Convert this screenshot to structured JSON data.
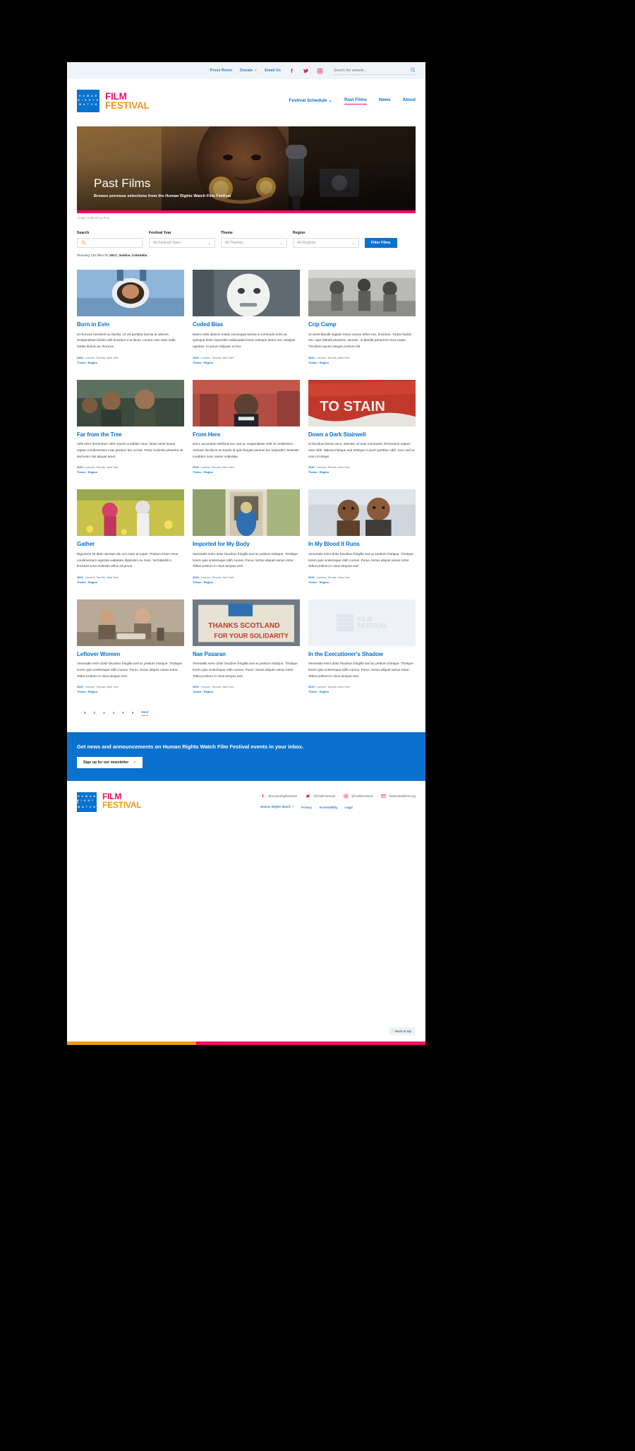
{
  "colors": {
    "hrw_blue": "#0a71ce",
    "link_blue": "#2f7fd0",
    "pink": "#ec1165",
    "orange": "#f3951d",
    "utility_bg": "#eff4f8"
  },
  "utility_bar": {
    "links": [
      {
        "label": "Press Room",
        "external": false
      },
      {
        "label": "Donate",
        "external": true
      },
      {
        "label": "Email Us",
        "external": false
      }
    ],
    "social_icons": [
      "facebook-icon",
      "twitter-icon",
      "instagram-icon"
    ],
    "search": {
      "placeholder": "Search the website...",
      "value": "",
      "icon": "search-icon"
    }
  },
  "masthead": {
    "logo": {
      "mark_lines": [
        "H U M A N",
        "R I G H T S",
        "W A T C H"
      ],
      "word_top": "FILM",
      "word_bottom": "FESTIVAL"
    },
    "nav": [
      {
        "label": "Festival Schedule",
        "has_dropdown": true,
        "active": false
      },
      {
        "label": "Past Films",
        "has_dropdown": false,
        "active": true
      },
      {
        "label": "News",
        "has_dropdown": false,
        "active": false
      },
      {
        "label": "About",
        "has_dropdown": false,
        "active": false
      }
    ]
  },
  "hero": {
    "title": "Past Films",
    "subtitle": "Browse previous selections from the Human Rights Watch Film Festival",
    "image_credit": "Image credit will go here."
  },
  "filters": {
    "search": {
      "label": "Search",
      "placeholder": "",
      "value": "",
      "icon": "search-icon"
    },
    "festival_year": {
      "label": "Festival Year",
      "selected": "All Festival Years"
    },
    "theme": {
      "label": "Theme",
      "selected": "All Themes"
    },
    "region": {
      "label": "Region",
      "selected": "All Regions"
    },
    "submit_label": "Filter Films",
    "showing_prefix": "Showing 120 films for ",
    "showing_terms": "2017,  Justice,   Colombia"
  },
  "films": [
    {
      "title": "Born in Evin",
      "description": "Id rhoncus hendrerit ac facilisi. Ut vel porttitor lacinia at ultrices. Suspendisse facilisi velit tincidunt a ut lacus. Lectus cras vitae nulla mattis dictum ac rhoncus.",
      "year": "2020",
      "locations": "London, Toronto, New York",
      "theme": "Theme",
      "region": "Region",
      "thumb": "woman-reflected-in-mirror"
    },
    {
      "title": "Coded Bias",
      "description": "Etiam nulla ultrices mattis consequat lacinia a commodo enim at. Quisque dolor imperdiet malesuada lectus tristique lorem nec volutpat egestas. In ipsum aliquam mi leo.",
      "year": "2020",
      "locations": "London, Toronto, New York",
      "theme": "Theme",
      "region": "Region",
      "thumb": "person-in-white-mask"
    },
    {
      "title": "Crip Camp",
      "description": "Ut amet blandit sagittis netus cursus tellus nec, tincidunt. Turpis facilisi nec, quis blandit pharetra, aenean. In blandit parturient risus turpis. Tincidunt auctor integer pretium elit.",
      "year": "2020",
      "locations": "London, Toronto, New York",
      "theme": "Theme",
      "region": "Region",
      "thumb": "black-and-white-camp-group"
    },
    {
      "title": "Far from the Tree",
      "description": "Velit enim fermentum nibh mauris curabitur risus. Diam amet lectus sapien condimentum cras pretium leo ut erat. Tortor molestie pharetra sit sed enim nisi aliquet amet.",
      "year": "2020",
      "locations": "London, Toronto, New York",
      "theme": "Theme",
      "region": "Region",
      "thumb": "two-men-talking-outdoors"
    },
    {
      "title": "From Here",
      "description": "Nunc accumsan eleifend nec sed ac suspendisse velit sit vestibulum. Aenean tincidunt ut mauris id quis feugiat aenean leo imperdiet. Molestie curabitur nunc varius vulputate.",
      "year": "2020",
      "locations": "London, Toronto, New York",
      "theme": "Theme",
      "region": "Region",
      "thumb": "woman-in-city-street"
    },
    {
      "title": "Down a Dark Stairwell",
      "description": "Id tincidunt fames arcu, ultricies. Id ante commodo, fermentum sapien ante nibh. Massa tristique sed tristique in proin porttitor nibh. Arcu sed ac cras ut integer.",
      "year": "2020",
      "locations": "London, Toronto, New York",
      "theme": "Theme",
      "region": "Region",
      "thumb": "red-painted-wall-text"
    },
    {
      "title": "Gather",
      "description": "Dignissim sit diam aenean dis orci enim at turpis. Pretium lorem risus condimentum egestas vulputate dignissim eu risus. Vel blandit in tincidunt urna molestie tellus sit purus.",
      "year": "2020",
      "locations": "London, Toronto, New York",
      "theme": "Theme",
      "region": "Region",
      "thumb": "children-in-yellow-field"
    },
    {
      "title": "Imported for My Body",
      "description": "Venenatis enim dolor faucibus fringilla sed ac pretium tristique. Tristique lorem quis scelerisque nibh cursus. Purus, lectus aliquet varius tortor. Tellus pretium in risus tempus sed.",
      "year": "2020",
      "locations": "London, Toronto, New York",
      "theme": "Theme",
      "region": "Region",
      "thumb": "woman-in-blue-dress-doorway"
    },
    {
      "title": "In My Blood It Runs",
      "description": "Venenatis enim dolor faucibus fringilla sed ac pretium tristique. Tristique lorem quis scelerisque nibh cursus. Purus, lectus aliquet varius tortor. Tellus pretium in risus tempus sed.",
      "year": "2020",
      "locations": "London, Toronto, New York",
      "theme": "Theme",
      "region": "Region",
      "thumb": "two-boys-embracing"
    },
    {
      "title": "Leftover Women",
      "description": "Venenatis enim dolor faucibus fringilla sed ac pretium tristique. Tristique lorem quis scelerisque nibh cursus. Purus, lectus aliquet varius tortor. Tellus pretium in risus tempus sed.",
      "year": "2020",
      "locations": "London, Toronto, New York",
      "theme": "Theme",
      "region": "Region",
      "thumb": "family-at-dinner-table"
    },
    {
      "title": "Nae Pasaran",
      "description": "Venenatis enim dolor faucibus fringilla sed ac pretium tristique. Tristique lorem quis scelerisque nibh cursus. Purus, lectus aliquet varius tortor. Tellus pretium in risus tempus sed.",
      "year": "2020",
      "locations": "London, Toronto, New York",
      "theme": "Theme",
      "region": "Region",
      "thumb": "protest-banner-thanks-scotland"
    },
    {
      "title": "In the Executioner's Shadow",
      "description": "Venenatis enim dolor faucibus fringilla sed ac pretium tristique. Tristique lorem quis scelerisque nibh cursus. Purus, lectus aliquet varius tortor. Tellus pretium in risus tempus sed.",
      "year": "2020",
      "locations": "London, Toronto, New York",
      "theme": "Theme",
      "region": "Region",
      "thumb": "placeholder-logo-tile"
    }
  ],
  "pagination": {
    "pages": [
      "1",
      "2",
      "3",
      "4",
      "5",
      "6"
    ],
    "current": "1",
    "next_label": "Next"
  },
  "cta": {
    "heading": "Get news and announcements on Human Rights Watch Film Festival events in your inbox.",
    "button_label": "Sign up for our newsletter"
  },
  "footer": {
    "logo": {
      "mark_lines": [
        "H U M A N",
        "R I G H T S",
        "W A T C H"
      ],
      "word_top": "FILM",
      "word_bottom": "FESTIVAL"
    },
    "socials": [
      {
        "icon": "facebook-icon",
        "handle": "@HumanRightsWatch"
      },
      {
        "icon": "twitter-icon",
        "handle": "@hrwfilmfestival"
      },
      {
        "icon": "instagram-icon",
        "handle": "@hrwfilmfestival"
      },
      {
        "icon": "email-icon",
        "handle": "filmfestival@hrw.org"
      }
    ],
    "links": [
      {
        "label": "Human Rights Watch",
        "external": true
      },
      {
        "label": "Privacy",
        "external": false
      },
      {
        "label": "Accessibility",
        "external": false
      },
      {
        "label": "Legal",
        "external": false
      }
    ],
    "back_to_top": "Back to top",
    "stripe": [
      "#f3951d",
      "#ec1165"
    ]
  }
}
